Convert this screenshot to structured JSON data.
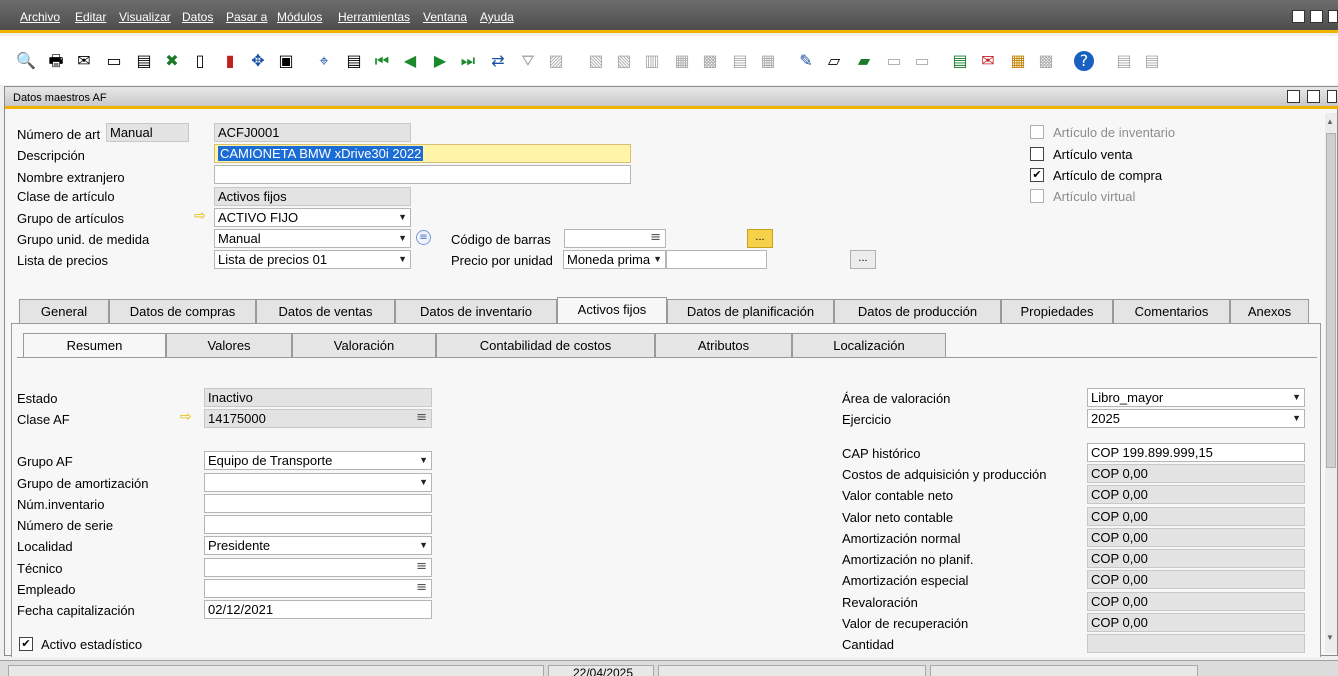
{
  "menu": [
    "Archivo",
    "Editar",
    "Visualizar",
    "Datos",
    "Pasar a",
    "Módulos",
    "Herramientas",
    "Ventana",
    "Ayuda"
  ],
  "window": {
    "title": "Datos maestros AF"
  },
  "header": {
    "numero_label": "Número de art",
    "numero_mode": "Manual",
    "numero_value": "ACFJ0001",
    "descripcion_label": "Descripción",
    "descripcion_value": "CAMIONETA BMW xDrive30i 2022",
    "nombre_ext_label": "Nombre extranjero",
    "nombre_ext_value": "",
    "clase_label": "Clase de artículo",
    "clase_value": "Activos fijos",
    "grupo_label": "Grupo de artículos",
    "grupo_value": "ACTIVO FIJO",
    "grupo_unid_label": "Grupo unid. de medida",
    "grupo_unid_value": "Manual",
    "lista_label": "Lista de precios",
    "lista_value": "Lista de precios 01",
    "codigo_label": "Código de barras",
    "codigo_value": "",
    "codigo_btn": "...",
    "precio_label": "Precio por unidad",
    "precio_currency": "Moneda prima",
    "precio_value": "",
    "precio_btn": "..."
  },
  "checkboxes": [
    {
      "label": "Artículo de inventario",
      "checked": false,
      "disabled": true
    },
    {
      "label": "Artículo venta",
      "checked": false,
      "disabled": false
    },
    {
      "label": "Artículo de compra",
      "checked": true,
      "disabled": false
    },
    {
      "label": "Artículo virtual",
      "checked": false,
      "disabled": true
    }
  ],
  "tabs": [
    "General",
    "Datos de compras",
    "Datos de ventas",
    "Datos de inventario",
    "Activos fijos",
    "Datos de planificación",
    "Datos de producción",
    "Propiedades",
    "Comentarios",
    "Anexos"
  ],
  "active_tab": "Activos fijos",
  "subtabs": [
    "Resumen",
    "Valores",
    "Valoración",
    "Contabilidad de costos",
    "Atributos",
    "Localización"
  ],
  "active_subtab": "Resumen",
  "left": {
    "estado_label": "Estado",
    "estado_value": "Inactivo",
    "clase_af_label": "Clase AF",
    "clase_af_value": "14175000",
    "grupo_af_label": "Grupo AF",
    "grupo_af_value": "Equipo de Transporte",
    "grupo_amort_label": "Grupo de amortización",
    "grupo_amort_value": "",
    "num_inv_label": "Núm.inventario",
    "num_inv_value": "",
    "num_serie_label": "Número de serie",
    "num_serie_value": "",
    "localidad_label": "Localidad",
    "localidad_value": "Presidente",
    "tecnico_label": "Técnico",
    "tecnico_value": "",
    "empleado_label": "Empleado",
    "empleado_value": "",
    "fecha_label": "Fecha capitalización",
    "fecha_value": "02/12/2021",
    "activo_est_label": "Activo estadístico",
    "activo_est_checked": true
  },
  "right": {
    "area_label": "Área de valoración",
    "area_value": "Libro_mayor",
    "ejercicio_label": "Ejercicio",
    "ejercicio_value": "2025",
    "rows": [
      {
        "label": "CAP histórico",
        "value": "COP 199.899.999,15",
        "readonly": false
      },
      {
        "label": "Costos de adquisición y producción",
        "value": "COP 0,00",
        "readonly": true
      },
      {
        "label": "Valor contable neto",
        "value": "COP 0,00",
        "readonly": true
      },
      {
        "label": "Valor neto contable",
        "value": "COP 0,00",
        "readonly": true
      },
      {
        "label": "Amortización normal",
        "value": "COP 0,00",
        "readonly": true
      },
      {
        "label": "Amortización no planif.",
        "value": "COP 0,00",
        "readonly": true
      },
      {
        "label": "Amortización especial",
        "value": "COP 0,00",
        "readonly": true
      },
      {
        "label": "Revaloración",
        "value": "COP 0,00",
        "readonly": true
      },
      {
        "label": "Valor de recuperación",
        "value": "COP 0,00",
        "readonly": true
      },
      {
        "label": "Cantidad",
        "value": "",
        "readonly": true
      }
    ]
  },
  "statusbar": {
    "date": "22/04/2025"
  },
  "colors": {
    "accent": "#f0b400",
    "selection": "#1c6cd6",
    "highlight": "#fff4a8"
  }
}
